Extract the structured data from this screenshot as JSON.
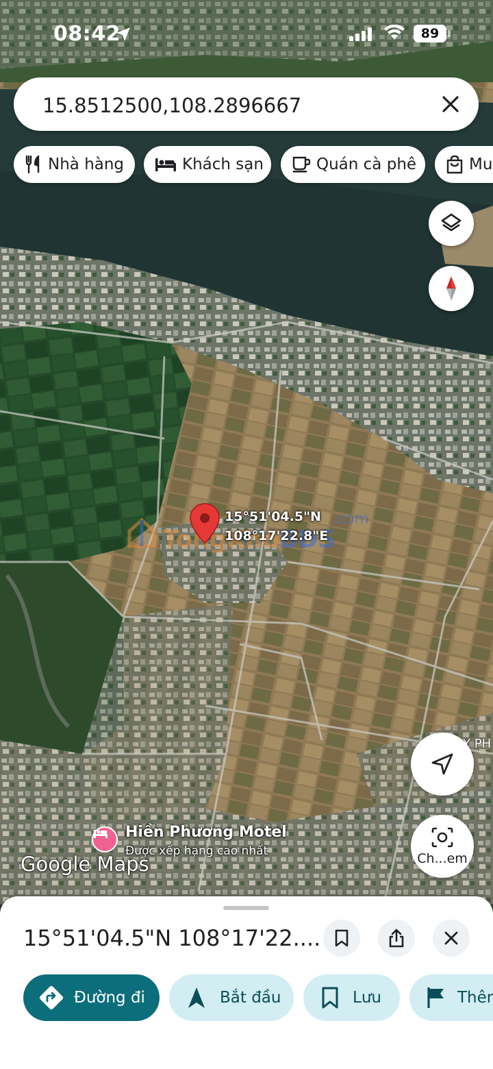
{
  "status_bar": {
    "time": "08:42",
    "battery": "89"
  },
  "search": {
    "query": "15.8512500,108.2896667"
  },
  "chips": [
    {
      "label": "Nhà hàng",
      "icon": "fork-knife-icon"
    },
    {
      "label": "Khách sạn",
      "icon": "bed-icon"
    },
    {
      "label": "Quán cà phê",
      "icon": "coffee-cup-icon"
    },
    {
      "label": "Mu",
      "icon": "shopping-bag-icon"
    }
  ],
  "map": {
    "pin_coord_lat": "15°51'04.5\"N",
    "pin_coord_lng": "108°17'22.8\"E",
    "watermark_main": "TongKho",
    "watermark_accent": "BDS",
    "watermark_com": ".com",
    "road_label": "Y PH",
    "poi_name": "Hiền Phương Motel",
    "poi_subtitle": "Được xếp hạng cao nhất",
    "attribution": "Google Maps",
    "camera_label": "Ch...em"
  },
  "sheet": {
    "title": "15°51'04.5\"N 108°17'22....",
    "actions": [
      {
        "label": "Đường đi",
        "icon": "directions-icon",
        "style": "primary"
      },
      {
        "label": "Bắt đầu",
        "icon": "navigation-arrow-icon",
        "style": "secondary"
      },
      {
        "label": "Lưu",
        "icon": "bookmark-icon",
        "style": "secondary"
      },
      {
        "label": "Thêm",
        "icon": "flag-icon",
        "style": "secondary"
      }
    ]
  },
  "colors": {
    "primary": "#0b6e7a",
    "secondary": "#d2eef3",
    "pin": "#e53935"
  }
}
